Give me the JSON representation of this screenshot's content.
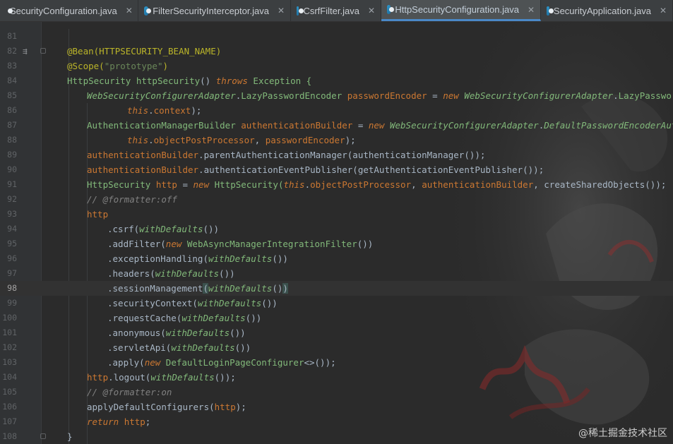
{
  "tabs": [
    {
      "label": "SecurityConfiguration.java",
      "active": false
    },
    {
      "label": "FilterSecurityInterceptor.java",
      "active": false
    },
    {
      "label": "CsrfFilter.java",
      "active": false
    },
    {
      "label": "HttpSecurityConfiguration.java",
      "active": true
    },
    {
      "label": "SecurityApplication.java",
      "active": false
    }
  ],
  "editor": {
    "current_line": "98",
    "lines": [
      {
        "n": "81"
      },
      {
        "n": "82"
      },
      {
        "n": "83"
      },
      {
        "n": "84"
      },
      {
        "n": "85"
      },
      {
        "n": "86"
      },
      {
        "n": "87"
      },
      {
        "n": "88"
      },
      {
        "n": "89"
      },
      {
        "n": "90"
      },
      {
        "n": "91"
      },
      {
        "n": "92"
      },
      {
        "n": "93"
      },
      {
        "n": "94"
      },
      {
        "n": "95"
      },
      {
        "n": "96"
      },
      {
        "n": "97"
      },
      {
        "n": "98"
      },
      {
        "n": "99"
      },
      {
        "n": "100"
      },
      {
        "n": "101"
      },
      {
        "n": "102"
      },
      {
        "n": "103"
      },
      {
        "n": "104"
      },
      {
        "n": "105"
      },
      {
        "n": "106"
      },
      {
        "n": "107"
      },
      {
        "n": "108"
      }
    ],
    "code": {
      "l82": [
        "@Bean(HTTPSECURITY_BEAN_NAME)"
      ],
      "l83": [
        "@Scope(",
        "\"prototype\"",
        ")"
      ],
      "l84": [
        "HttpSecurity ",
        "httpSecurity",
        "() ",
        "throws ",
        "Exception {"
      ],
      "l85": [
        "WebSecurityConfigurerAdapter",
        ".",
        "LazyPasswordEncoder ",
        "passwordEncoder",
        " = ",
        "new ",
        "WebSecurityConfigurerAdapter",
        ".",
        "LazyPasswordEncoder("
      ],
      "l86": [
        "this",
        ".",
        "context",
        ");"
      ],
      "l87": [
        "AuthenticationManagerBuilder ",
        "authenticationBuilder",
        " = ",
        "new ",
        "WebSecurityConfigurerAdapter",
        ".",
        "DefaultPasswordEncoderAuthenticationManagerBuilder("
      ],
      "l88": [
        "this",
        ".",
        "objectPostProcessor",
        ", ",
        "passwordEncoder",
        ");"
      ],
      "l89": [
        "authenticationBuilder",
        ".parentAuthenticationManager(authenticationManager());"
      ],
      "l90": [
        "authenticationBuilder",
        ".authenticationEventPublisher(getAuthenticationEventPublisher());"
      ],
      "l91": [
        "HttpSecurity ",
        "http",
        " = ",
        "new ",
        "HttpSecurity(",
        "this",
        ".",
        "objectPostProcessor",
        ", ",
        "authenticationBuilder",
        ", createSharedObjects());"
      ],
      "l92": [
        "// @formatter:off"
      ],
      "l93": [
        "http"
      ],
      "l94": [
        ".csrf(",
        "withDefaults",
        "())"
      ],
      "l95": [
        ".addFilter(",
        "new ",
        "WebAsyncManagerIntegrationFilter",
        "())"
      ],
      "l96": [
        ".exceptionHandling(",
        "withDefaults",
        "())"
      ],
      "l97": [
        ".headers(",
        "withDefaults",
        "())"
      ],
      "l98": [
        ".sessionManagement",
        "(",
        "withDefaults",
        "()",
        ")"
      ],
      "l99": [
        ".securityContext(",
        "withDefaults",
        "())"
      ],
      "l100": [
        ".requestCache(",
        "withDefaults",
        "())"
      ],
      "l101": [
        ".anonymous(",
        "withDefaults",
        "())"
      ],
      "l102": [
        ".servletApi(",
        "withDefaults",
        "())"
      ],
      "l103": [
        ".apply(",
        "new ",
        "DefaultLoginPageConfigurer",
        "<>());"
      ],
      "l104": [
        "http",
        ".logout(",
        "withDefaults",
        "());"
      ],
      "l105": [
        "// @formatter:on"
      ],
      "l106": [
        "applyDefaultConfigurers(",
        "http",
        ");"
      ],
      "l107": [
        "return ",
        "http",
        ";"
      ],
      "l108": [
        "}"
      ]
    }
  },
  "watermark": "@稀土掘金技术社区"
}
